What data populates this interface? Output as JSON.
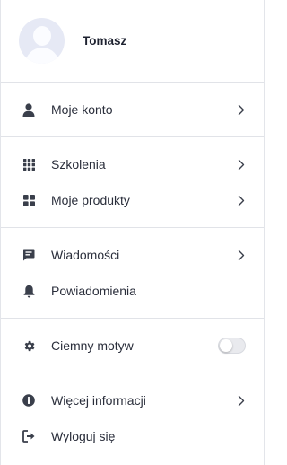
{
  "profile": {
    "name": "Tomasz"
  },
  "menu": {
    "account": {
      "label": "Moje konto",
      "icon": "user-icon"
    },
    "courses": {
      "label": "Szkolenia",
      "icon": "grid-icon"
    },
    "products": {
      "label": "Moje produkty",
      "icon": "apps-icon"
    },
    "messages": {
      "label": "Wiadomości",
      "icon": "message-icon"
    },
    "notifications": {
      "label": "Powiadomienia",
      "icon": "bell-icon"
    },
    "dark_mode": {
      "label": "Ciemny motyw",
      "icon": "gear-icon",
      "enabled": false
    },
    "more_info": {
      "label": "Więcej informacji",
      "icon": "info-icon"
    },
    "logout": {
      "label": "Wyloguj się",
      "icon": "logout-icon"
    }
  },
  "colors": {
    "icon": "#3a3f4b",
    "divider": "#e1e3e8",
    "avatar_bg": "#e6e9f5"
  }
}
